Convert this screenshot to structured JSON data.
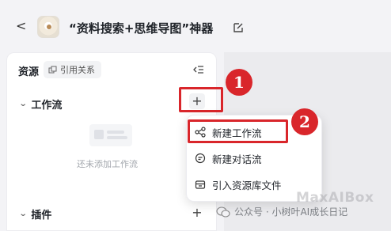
{
  "header": {
    "back_glyph": "<",
    "title": "“资料搜索+思维导图”神器",
    "edit_icon": "edit-icon"
  },
  "sidebar": {
    "resources_label": "资源",
    "ref_badge_label": "引用关系",
    "sections": {
      "workflow": {
        "label": "工作流",
        "add_glyph": "+"
      },
      "plugins": {
        "label": "插件",
        "add_glyph": "+"
      }
    },
    "empty_text": "还未添加工作流"
  },
  "dropdown": {
    "items": [
      {
        "label": "新建工作流",
        "icon": "workflow-icon"
      },
      {
        "label": "新建对话流",
        "icon": "chat-flow-icon"
      },
      {
        "label": "引入资源库文件",
        "icon": "library-icon"
      }
    ]
  },
  "annotations": {
    "badge_1": "1",
    "badge_2": "2",
    "color": "#d9262b"
  },
  "watermark": {
    "text": "公众号 · 小树叶AI成长日记",
    "brand": "MaxAIBox"
  }
}
